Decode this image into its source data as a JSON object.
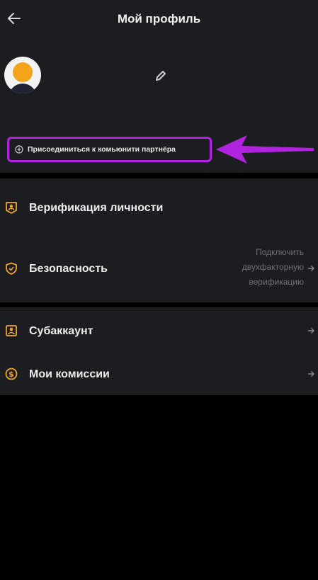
{
  "header": {
    "title": "Мой профиль",
    "back_icon": "arrow-left-icon"
  },
  "profile": {
    "avatar_icon": "user-avatar-icon",
    "edit_icon": "pencil-icon"
  },
  "community": {
    "label": "Присоединиться к комьюнити партнёра",
    "icon": "plus-circle-icon",
    "highlight_color": "#b024e0"
  },
  "menu": {
    "verification": {
      "label": "Верификация личности",
      "icon": "id-badge-icon"
    },
    "security": {
      "label": "Безопасность",
      "icon": "shield-icon",
      "hint": "Подключить двухфакторную верификацию"
    },
    "subaccount": {
      "label": "Субаккаунт",
      "icon": "user-card-icon"
    },
    "commissions": {
      "label": "Мои комиссии",
      "icon": "dollar-circle-icon"
    }
  },
  "colors": {
    "panel": "#1c1d21",
    "background": "#000000",
    "accent_avatar": "#f4a41c",
    "annotation": "#b024e0"
  }
}
